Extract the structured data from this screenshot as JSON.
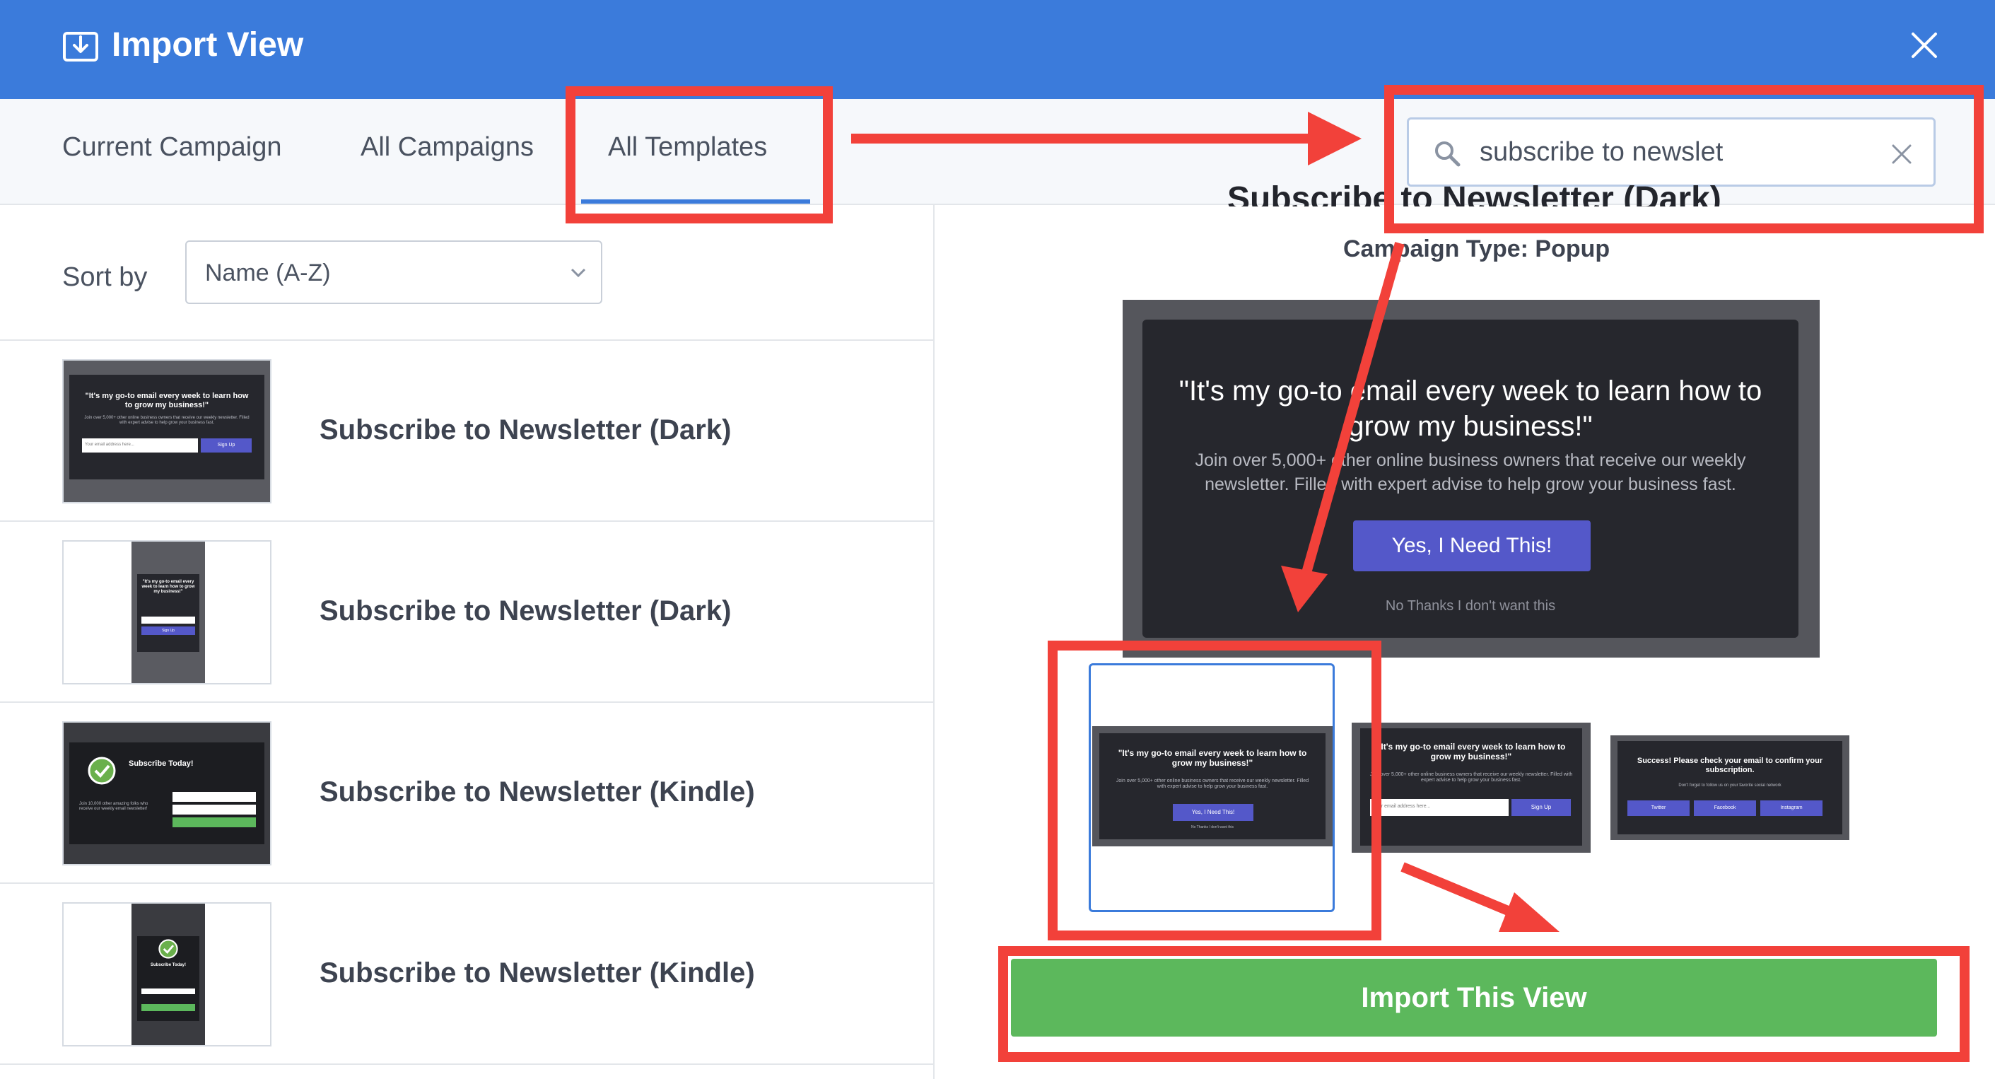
{
  "header": {
    "title": "Import View",
    "icon": "import-tray-icon",
    "close_icon": "close-icon",
    "background": "#3b7bdb"
  },
  "tabs": [
    {
      "label": "Current Campaign",
      "active": false
    },
    {
      "label": "All Campaigns",
      "active": false
    },
    {
      "label": "All Templates",
      "active": true
    }
  ],
  "search": {
    "value": "subscribe to newslet",
    "icon": "search-icon",
    "clear_icon": "clear-icon"
  },
  "sort": {
    "label": "Sort by",
    "selected": "Name (A-Z)"
  },
  "templates": [
    {
      "name": "Subscribe to Newsletter (Dark)"
    },
    {
      "name": "Subscribe to Newsletter (Dark)"
    },
    {
      "name": "Subscribe to Newsletter (Kindle)"
    },
    {
      "name": "Subscribe to Newsletter (Kindle)"
    }
  ],
  "thumbnails": {
    "dark_quote": "\"It's my go-to email every week to learn how to grow my business!\"",
    "dark_desc": "Join over 5,000+ other online business owners that receive our weekly newsletter. Filled with expert advise to help grow your business fast.",
    "email_placeholder": "Your email address here...",
    "signup": "Sign Up",
    "kindle_title": "Subscribe Today!",
    "kindle_sub": "Join 10,000 other amazing folks who receive our weekly email newsletter!"
  },
  "preview": {
    "heading": "Subscribe to Newsletter (Dark)",
    "campaign_type": "Campaign Type: Popup",
    "quote": "\"It's my go-to email every week to learn how to grow my business!\"",
    "description": "Join over 5,000+ other online business owners that receive our weekly newsletter. Filled with expert advise to help grow your business fast.",
    "button": "Yes, I Need This!",
    "no_thanks": "No Thanks I don't want this"
  },
  "variants": {
    "v1_button": "Yes, I Need This!",
    "v2_signup": "Sign Up",
    "v3_success": "Success! Please check your email to confirm your subscription.",
    "v3_sub": "Don't forget to follow us on your favorite social network",
    "v3_social": [
      "Twitter",
      "Facebook",
      "Instagram"
    ]
  },
  "import_button": {
    "label": "Import This View",
    "color": "#5cb85c"
  },
  "annotation_color": "#f2413a"
}
